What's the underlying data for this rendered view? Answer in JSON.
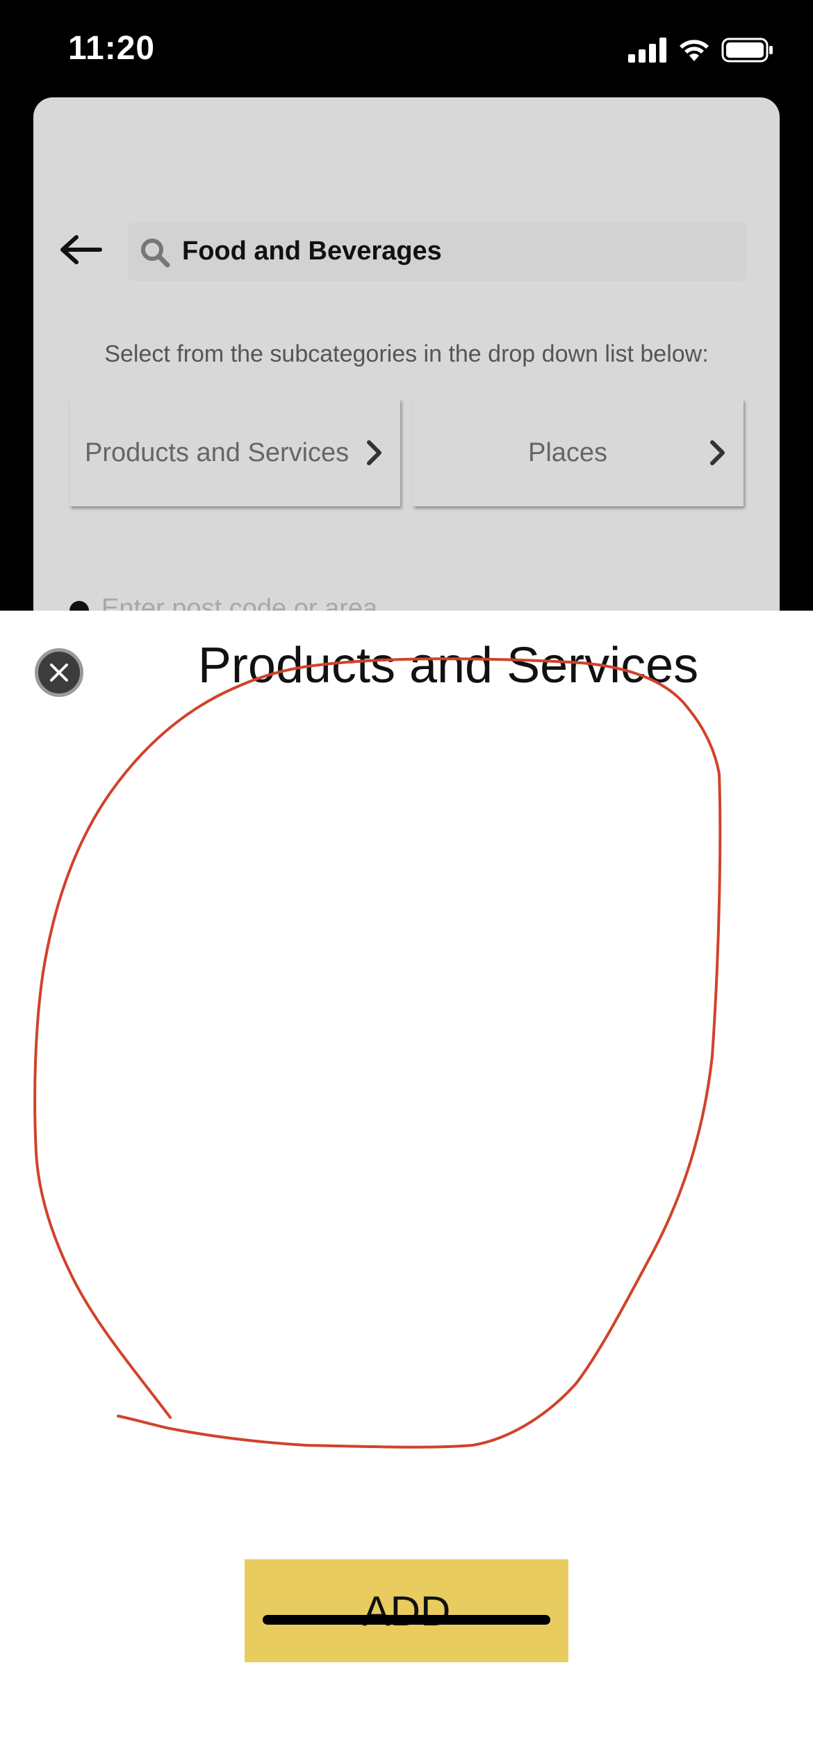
{
  "status_bar": {
    "time": "11:20",
    "icons": [
      "cellular-signal-icon",
      "wifi-icon",
      "battery-icon"
    ]
  },
  "background": {
    "search_value": "Food and Beverages",
    "select_hint": "Select from the subcategories in the drop down list below:",
    "subcategories": [
      {
        "label": "Products and Services"
      },
      {
        "label": "Places"
      }
    ],
    "post_code_placeholder": "Enter post code or area"
  },
  "sheet": {
    "title": "Products and Services",
    "add_label": "ADD",
    "annotation_color": "#d0432a"
  },
  "colors": {
    "add_button": "#e8cc60",
    "card_background": "#d8d8d8"
  }
}
